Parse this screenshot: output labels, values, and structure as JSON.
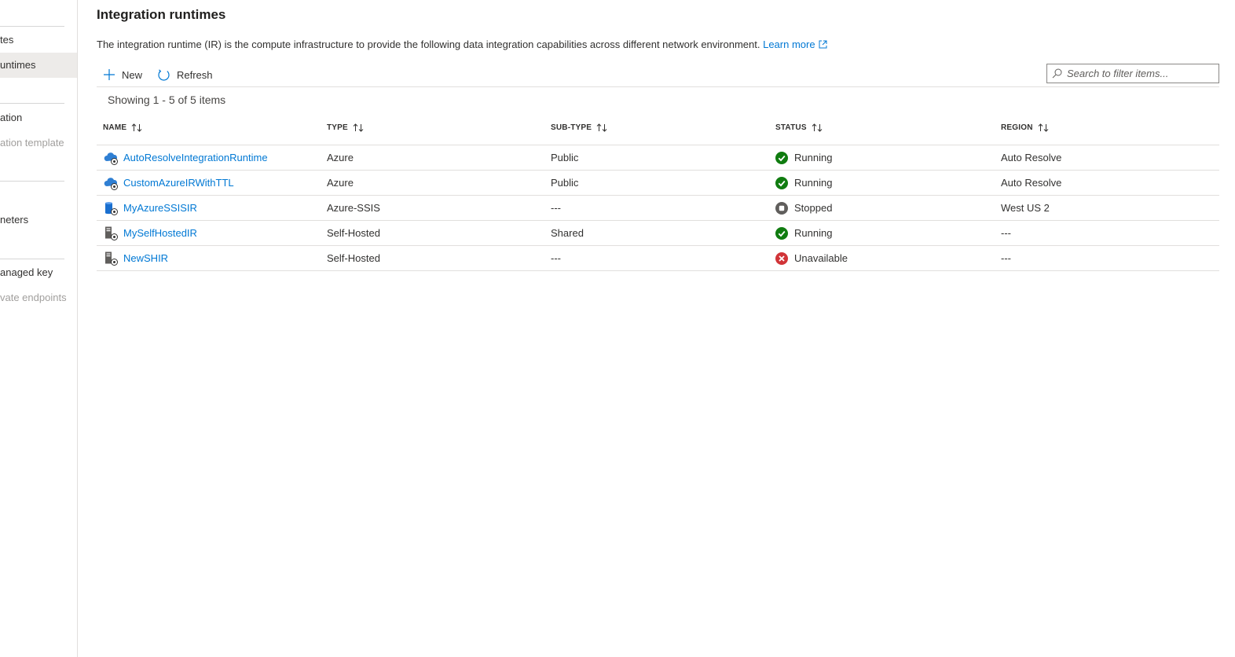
{
  "sidebar": {
    "items": [
      {
        "label": "tes",
        "state": "normal"
      },
      {
        "label": "untimes",
        "state": "selected"
      },
      {
        "label": "ation",
        "state": "normal"
      },
      {
        "label": "ation template",
        "state": "disabled"
      },
      {
        "label": "neters",
        "state": "normal"
      },
      {
        "label": "anaged key",
        "state": "normal"
      },
      {
        "label": "vate endpoints",
        "state": "disabled"
      }
    ]
  },
  "page": {
    "title": "Integration runtimes",
    "description": "The integration runtime (IR) is the compute infrastructure to provide the following data integration capabilities across different network environment.",
    "learn_more": "Learn more"
  },
  "toolbar": {
    "new_label": "New",
    "refresh_label": "Refresh",
    "search_placeholder": "Search to filter items..."
  },
  "summary": "Showing 1 - 5 of 5 items",
  "table": {
    "columns": [
      "NAME",
      "TYPE",
      "SUB-TYPE",
      "STATUS",
      "REGION"
    ],
    "rows": [
      {
        "name": "AutoResolveIntegrationRuntime",
        "icon": "azure-cloud-icon",
        "type": "Azure",
        "subtype": "Public",
        "status": "Running",
        "status_icon": "check-circle-icon",
        "region": "Auto Resolve"
      },
      {
        "name": "CustomAzureIRWithTTL",
        "icon": "azure-cloud-icon",
        "type": "Azure",
        "subtype": "Public",
        "status": "Running",
        "status_icon": "check-circle-icon",
        "region": "Auto Resolve"
      },
      {
        "name": "MyAzureSSISIR",
        "icon": "ssis-database-icon",
        "type": "Azure-SSIS",
        "subtype": "---",
        "status": "Stopped",
        "status_icon": "stop-circle-icon",
        "region": "West US 2"
      },
      {
        "name": "MySelfHostedIR",
        "icon": "server-icon",
        "type": "Self-Hosted",
        "subtype": "Shared",
        "status": "Running",
        "status_icon": "check-circle-icon",
        "region": "---"
      },
      {
        "name": "NewSHIR",
        "icon": "server-icon",
        "type": "Self-Hosted",
        "subtype": "---",
        "status": "Unavailable",
        "status_icon": "error-circle-icon",
        "region": "---"
      }
    ]
  },
  "colors": {
    "link": "#0078d4",
    "success": "#107c10",
    "error": "#d13438",
    "stopped": "#605e5c",
    "selected_bg": "#edebe9"
  }
}
